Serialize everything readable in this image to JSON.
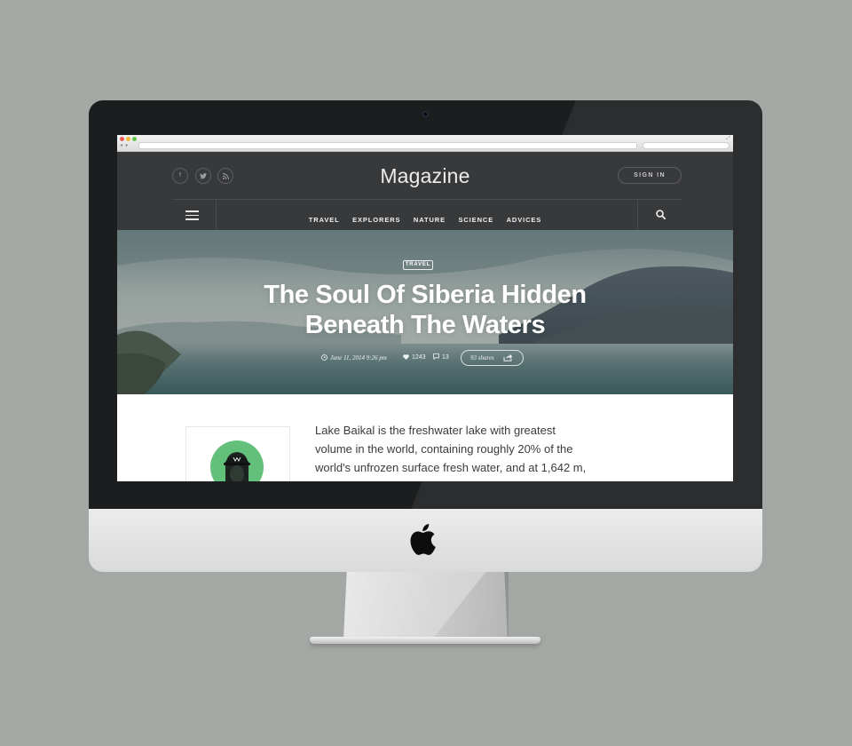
{
  "browser": {
    "nav_arrows": "◂ ▸",
    "fullscreen_icon": "⤢"
  },
  "site": {
    "logo": "Magazine",
    "sign_in_label": "SIGN IN",
    "social": {
      "facebook_glyph": "f",
      "twitter_glyph": "t",
      "rss_glyph": ")"
    },
    "nav": {
      "items": [
        "TRAVEL",
        "EXPLORERS",
        "NATURE",
        "SCIENCE",
        "ADVICES"
      ]
    }
  },
  "hero": {
    "category": "TRAVEL",
    "title_line1": "The Soul Of Siberia Hidden",
    "title_line2": "Beneath The Waters",
    "date": "June 11, 2014 9:26 pm",
    "likes": "1243",
    "comments": "13",
    "shares": "93 shares"
  },
  "article": {
    "lines": [
      "Lake Baikal is the freshwater lake with greatest",
      "volume in the world, containing roughly 20% of the",
      "world's unfrozen surface fresh water, and at 1,642 m,"
    ]
  },
  "colors": {
    "header_bg": "#38393b",
    "avatar_bg": "#63c07a",
    "page_bg": "#a3a8a4"
  }
}
